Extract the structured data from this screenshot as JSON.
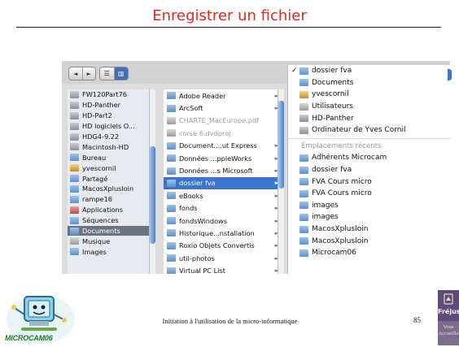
{
  "slide": {
    "title": "Enregistrer un fichier"
  },
  "toolbar": {
    "back_label": "◄",
    "forward_label": "►",
    "list_view_label": "☰",
    "column_view_label": "▥"
  },
  "sidebar": {
    "items": [
      {
        "label": "FW120Part76",
        "icon": "drive-icon"
      },
      {
        "label": "HD-Panther",
        "icon": "drive-icon"
      },
      {
        "label": "HD-Part2",
        "icon": "drive-icon"
      },
      {
        "label": "HD logiciels O...",
        "icon": "drive-icon"
      },
      {
        "label": "HDG4-9.22",
        "icon": "drive-icon"
      },
      {
        "label": "Macintosh-HD",
        "icon": "drive-icon"
      },
      {
        "label": "Bureau",
        "icon": "folder-icon"
      },
      {
        "label": "yvescornil",
        "icon": "home-icon"
      },
      {
        "label": "Partagé",
        "icon": "folder-icon"
      },
      {
        "label": "MacosXplusloin",
        "icon": "folder-icon"
      },
      {
        "label": "rampe16",
        "icon": "folder-icon"
      },
      {
        "label": "Applications",
        "icon": "applications-icon"
      },
      {
        "label": "Séquences",
        "icon": "folder-icon"
      },
      {
        "label": "Documents",
        "icon": "folder-icon",
        "selected": true
      },
      {
        "label": "Musique",
        "icon": "music-icon"
      },
      {
        "label": "Images",
        "icon": "folder-icon"
      }
    ]
  },
  "column2": {
    "items": [
      {
        "label": "Adobe Reader",
        "arrow": "►"
      },
      {
        "label": "ArcSoft",
        "arrow": "►"
      },
      {
        "label": "CHARTE_MacEurope.pdf",
        "faded": true
      },
      {
        "label": "corse 6.dvdproj",
        "faded": true
      },
      {
        "label": "Document....ut Express",
        "arrow": "►"
      },
      {
        "label": "Données ...ppleWorks",
        "arrow": "►"
      },
      {
        "label": "Données ...s Microsoft",
        "arrow": "►"
      },
      {
        "label": "dossier fva",
        "arrow": "►",
        "selected": true
      },
      {
        "label": "eBooks",
        "arrow": "►"
      },
      {
        "label": "fonds",
        "arrow": "►"
      },
      {
        "label": "fondsWindows",
        "arrow": "►"
      },
      {
        "label": "Historique...nstallation",
        "arrow": "►"
      },
      {
        "label": "Roxio Objets Convertis",
        "arrow": "►"
      },
      {
        "label": "util-photos",
        "arrow": "►"
      },
      {
        "label": "Virtual PC List",
        "arrow": "►"
      }
    ]
  },
  "menu": {
    "checkmark": "✓",
    "items": [
      {
        "label": "dossier fva",
        "checked": true,
        "icon": "folder-icon"
      },
      {
        "label": "Documents",
        "icon": "folder-icon"
      },
      {
        "label": "yvescornil",
        "icon": "home-icon"
      },
      {
        "label": "Utilisateurs",
        "icon": "users-icon"
      },
      {
        "label": "HD-Panther",
        "icon": "drive-icon"
      },
      {
        "label": "Ordinateur de Yves Cornil",
        "icon": "computer-icon"
      }
    ],
    "recent_header": "Emplacements récents",
    "recent_items": [
      {
        "label": "Adhérents Microcam",
        "icon": "folder-icon"
      },
      {
        "label": "dossier fva",
        "icon": "folder-icon"
      },
      {
        "label": "FVA Cours micro",
        "icon": "folder-icon"
      },
      {
        "label": "FVA Cours micro",
        "icon": "folder-icon"
      },
      {
        "label": "images",
        "icon": "folder-icon"
      },
      {
        "label": "images",
        "icon": "folder-icon"
      },
      {
        "label": "MacosXplusloin",
        "icon": "folder-icon"
      },
      {
        "label": "MacosXplusloin",
        "icon": "folder-icon"
      },
      {
        "label": "Microcam06",
        "icon": "folder-icon"
      }
    ]
  },
  "footer": {
    "logo_text": "MICROCAM06",
    "caption": "Initiation à l'utilisation de la micro-informatique",
    "page_number": "85",
    "frejus_title": "Fréjus",
    "frejus_subtitle": "Vous Accueille"
  },
  "colors": {
    "title": "#e0271d",
    "selection": "#3d74d0",
    "sidebar_selection": "#6b7380",
    "logo_green": "#1f7a32"
  }
}
